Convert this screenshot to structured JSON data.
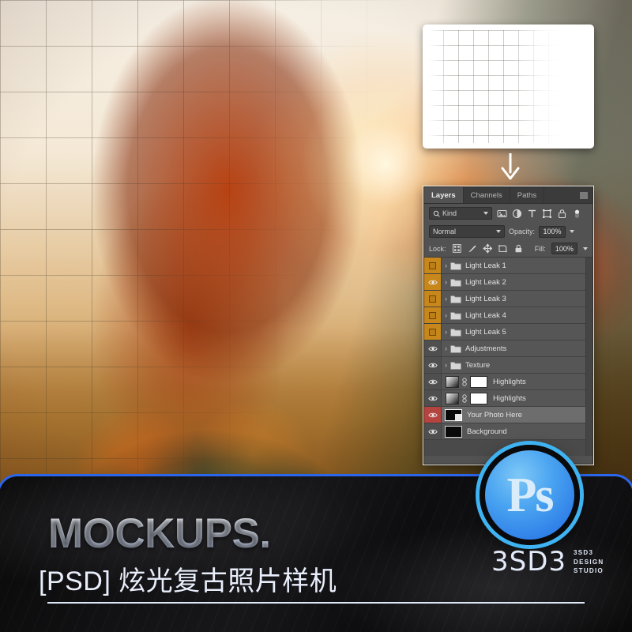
{
  "background": {
    "description": "retro light-leak portrait photo of woman by chain-link fence"
  },
  "preview": {
    "name": "photo-preview-thumbnail"
  },
  "arrow": {
    "name": "down-arrow"
  },
  "panel": {
    "tabs": [
      {
        "label": "Layers",
        "active": true
      },
      {
        "label": "Channels",
        "active": false
      },
      {
        "label": "Paths",
        "active": false
      }
    ],
    "filter": {
      "kind_label": "Kind",
      "icons": [
        "pixel-layer-filter-icon",
        "adjustment-layer-filter-icon",
        "type-layer-filter-icon",
        "shape-layer-filter-icon",
        "smart-object-filter-icon",
        "filter-toggle-icon"
      ]
    },
    "blend": {
      "mode": "Normal",
      "opacity_label": "Opacity:",
      "opacity_value": "100%"
    },
    "lock": {
      "label": "Lock:",
      "fill_label": "Fill:",
      "fill_value": "100%",
      "icons": [
        "lock-transparent-pixels-icon",
        "lock-image-pixels-icon",
        "lock-position-icon",
        "lock-artboard-icon",
        "lock-all-icon"
      ]
    },
    "layers": [
      {
        "name": "Light Leak 1",
        "type": "group",
        "visible": false,
        "eye_color": "#c8871a",
        "selected": false
      },
      {
        "name": "Light Leak 2",
        "type": "group",
        "visible": true,
        "eye_color": "#c8871a",
        "selected": false
      },
      {
        "name": "Light Leak 3",
        "type": "group",
        "visible": false,
        "eye_color": "#c8871a",
        "selected": false
      },
      {
        "name": "Light Leak 4",
        "type": "group",
        "visible": false,
        "eye_color": "#c8871a",
        "selected": false
      },
      {
        "name": "Light Leak 5",
        "type": "group",
        "visible": false,
        "eye_color": "#c8871a",
        "selected": false
      },
      {
        "name": "Adjustments",
        "type": "group",
        "visible": true,
        "eye_color": "#4f4f4f",
        "selected": false
      },
      {
        "name": "Texture",
        "type": "group",
        "visible": true,
        "eye_color": "#4f4f4f",
        "selected": false
      },
      {
        "name": "Highlights",
        "type": "masked",
        "visible": true,
        "eye_color": "#4f4f4f",
        "selected": false
      },
      {
        "name": "Highlights",
        "type": "masked",
        "visible": true,
        "eye_color": "#4f4f4f",
        "selected": false
      },
      {
        "name": "Your Photo Here",
        "type": "smart-object",
        "visible": true,
        "eye_color": "#b5433f",
        "selected": true
      },
      {
        "name": "Background",
        "type": "raster",
        "visible": true,
        "eye_color": "#4f4f4f",
        "selected": false
      }
    ]
  },
  "banner": {
    "title": "MOCKUPS.",
    "subtitle": "[PSD] 炫光复古照片样机",
    "accent_color": "#2b66ec"
  },
  "badge": {
    "label": "Ps",
    "ring_color": "#3fb3f2"
  },
  "studio": {
    "mark": "3SD3",
    "line1": "3SD3",
    "line2": "DESIGN",
    "line3": "STUDIO"
  }
}
